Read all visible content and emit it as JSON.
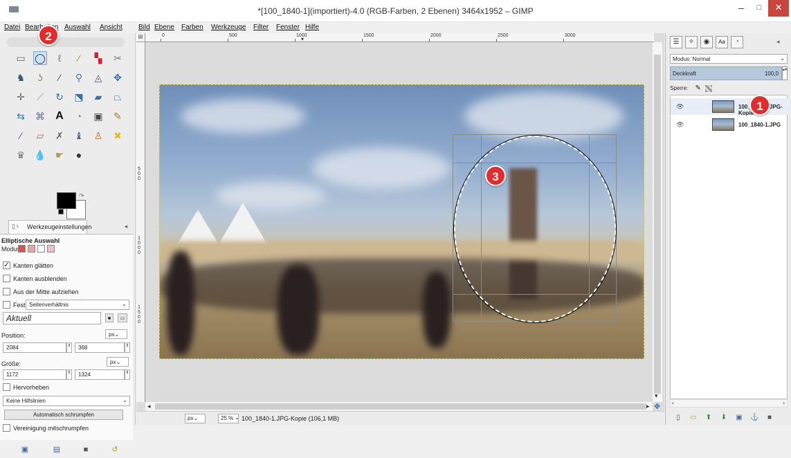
{
  "window": {
    "title": "*[100_1840-1](importiert)-4.0 (RGB-Farben, 2 Ebenen) 3464x1952 – GIMP",
    "min": "–",
    "max": "□",
    "close": "✕"
  },
  "menu": [
    "Datei",
    "Bearbeiten",
    "Auswahl",
    "Ansicht",
    "Bild",
    "Ebene",
    "Farben",
    "Werkzeuge",
    "Filter",
    "Fenster",
    "Hilfe"
  ],
  "toolbox": {
    "tools": [
      "rect-select",
      "ellipse-select",
      "free-select",
      "fuzzy-select",
      "by-color-select",
      "scissors",
      "foreground-select",
      "paths",
      "color-picker",
      "zoom",
      "measure",
      "move",
      "align",
      "crop",
      "rotate",
      "scale",
      "shear",
      "perspective",
      "flip",
      "cage",
      "unified-transform",
      "warp",
      "text",
      "bucket-fill",
      "blend",
      "pencil",
      "paintbrush",
      "eraser",
      "airbrush",
      "ink",
      "clone",
      "heal",
      "perspective-clone",
      "blur",
      "smudge",
      "dodge-burn"
    ],
    "colors": {
      "fg": "#000000",
      "bg": "#ffffff"
    }
  },
  "tool_options": {
    "tab_label": "Werkzeugeinstellungen",
    "heading": "Elliptische Auswahl",
    "modus_label": "Modus:",
    "kanten_glaetten": "Kanten glätten",
    "kanten_glaetten_checked": "✓",
    "kanten_ausblenden": "Kanten ausblenden",
    "aus_mitte": "Aus der Mitte aufziehen",
    "fest_label": "Fest:",
    "fest_value": "Seitenverhältnis",
    "aktuell": "Aktuell",
    "position_label": "Position:",
    "unit": "px",
    "pos_x": "2084",
    "pos_y": "368",
    "groesse_label": "Größe:",
    "size_w": "1172",
    "size_h": "1324",
    "hervorheben": "Hervorheben",
    "hilfslinien": "Keine Hilfslinien",
    "auto_shrink": "Automatisch schrumpfen",
    "vereinigung": "Vereinigung mitschrumpfen"
  },
  "ruler": {
    "labels": [
      "0",
      "500",
      "1000",
      "1500",
      "2000",
      "2500",
      "3000"
    ],
    "v_labels": [
      "500",
      "1000",
      "1500"
    ]
  },
  "status": {
    "unit": "px",
    "zoom": "25 %",
    "info": "100_1840-1.JPG-Kopie (106,1 MB)"
  },
  "layers_panel": {
    "mode": "Modus: Normal",
    "opacity_label": "Deckkraft",
    "opacity_value": "100,0",
    "lock_label": "Sperre:",
    "layers": [
      {
        "name": "100_1840-1.JPG-Kopie",
        "visible": true,
        "active": true
      },
      {
        "name": "100_1840-1.JPG",
        "visible": true,
        "active": false
      }
    ]
  },
  "badges": [
    "1",
    "2",
    "3"
  ],
  "colors": {
    "badge": "#e12d2d",
    "selection": "#cde2f6",
    "close": "#c7463e"
  }
}
